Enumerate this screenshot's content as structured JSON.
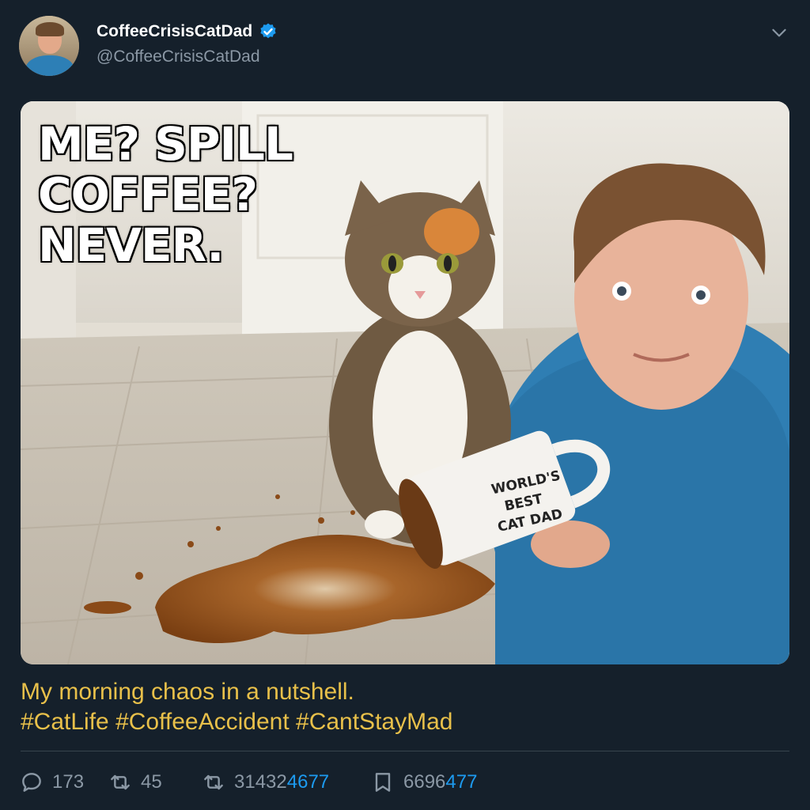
{
  "author": {
    "display_name": "CoffeeCrisisCatDad",
    "handle": "@CoffeeCrisisCatDad",
    "verified": true,
    "verified_icon": "verified-badge-icon",
    "avatar": "avatar-photo"
  },
  "menu": {
    "icon": "chevron-down-icon"
  },
  "media": {
    "overlay_lines": [
      "ME? SPILL",
      "COFFEE?",
      "NEVER."
    ],
    "mug_text": [
      "WORLD'S",
      "BEST",
      "CAT DAD"
    ]
  },
  "caption": {
    "line1": "My morning chaos in a nutshell.",
    "line2": "#CatLife #CoffeeAccident #CantStayMad"
  },
  "actions": {
    "replies": {
      "icon": "reply-icon",
      "count": "173"
    },
    "retweets": {
      "icon": "retweet-icon",
      "count": "45"
    },
    "quotes": {
      "icon": "retweet-icon",
      "count_main": "31432",
      "count_highlight": "4677"
    },
    "bookmarks": {
      "icon": "bookmark-icon",
      "count_main": "6696",
      "count_highlight": "477"
    }
  },
  "colors": {
    "background": "#15202b",
    "accent": "#1d9bf0",
    "caption": "#e8c04a",
    "muted": "#8b98a5"
  }
}
